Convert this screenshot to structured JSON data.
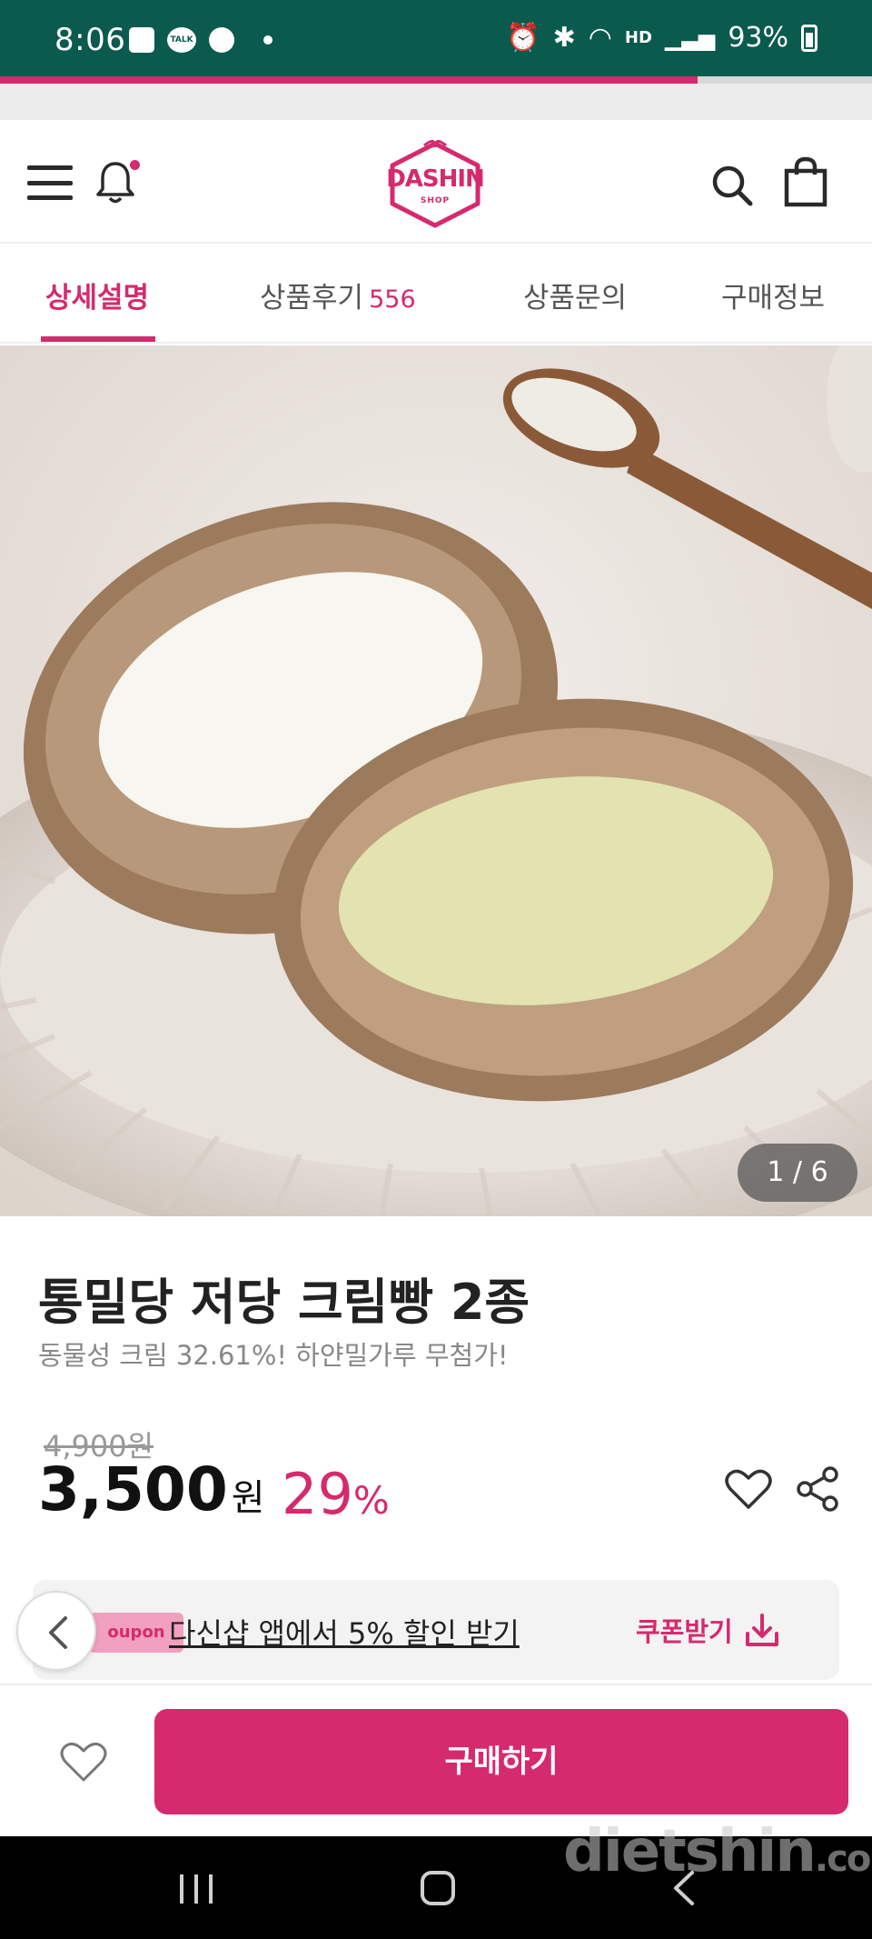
{
  "status_bar": {
    "time": "8:06",
    "talk_label": "TALK",
    "right": {
      "network": "HD",
      "battery": "93%"
    }
  },
  "page_load_progress": 0.8,
  "header": {
    "logo_text": "DASHIN",
    "logo_sub": "SHOP",
    "notification_dot": true
  },
  "tabs": [
    {
      "label": "상세설명",
      "active": true
    },
    {
      "label": "상품후기",
      "count": "556"
    },
    {
      "label": "상품문의"
    },
    {
      "label": "구매정보"
    }
  ],
  "gallery": {
    "pager": "1 / 6"
  },
  "product": {
    "title": "통밀당 저당 크림빵 2종",
    "subtitle": "동물성 크림 32.61%! 하얀밀가루 무첨가!",
    "original_price": "4,900원",
    "sale_price": "3,500",
    "sale_unit": "원",
    "discount": "29",
    "discount_unit": "%"
  },
  "coupon": {
    "tag": "oupon",
    "text": "다신샵 앱에서 5% 할인 받기",
    "button_label": "쿠폰받기"
  },
  "bottom_bar": {
    "buy_label": "구매하기"
  },
  "watermark": {
    "main": "dietshin",
    "suffix": ".com"
  },
  "colors": {
    "brand": "#d52a6e",
    "status_bar": "#0b5a4e"
  },
  "icons": [
    "menu-icon",
    "bell-icon",
    "search-icon",
    "shopping-bag-icon",
    "heart-icon",
    "share-icon",
    "download-icon",
    "chevron-left-icon"
  ]
}
